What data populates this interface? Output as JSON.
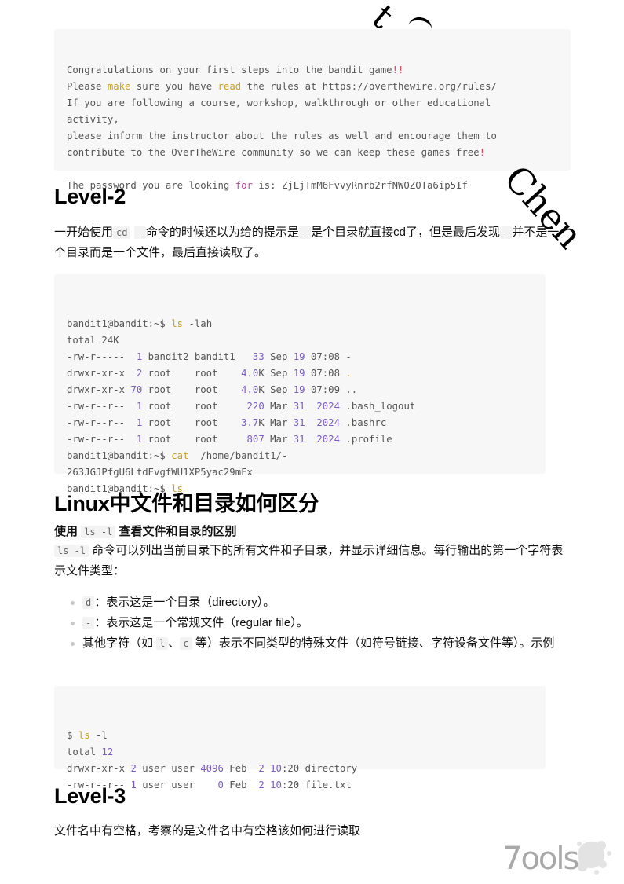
{
  "intro_code": {
    "lines": [
      [
        {
          "t": "Congratulations on your first steps into the bandit game"
        },
        {
          "t": "!!",
          "c": "kw-r"
        }
      ],
      [
        {
          "t": "Please "
        },
        {
          "t": "make",
          "c": "kw-y"
        },
        {
          "t": " sure you have "
        },
        {
          "t": "read",
          "c": "kw-y"
        },
        {
          "t": " the rules at https://overthewire.org/rules/"
        }
      ],
      [
        {
          "t": "If you are following a course, workshop, walkthrough or other educational"
        }
      ],
      [
        {
          "t": "activity,"
        }
      ],
      [
        {
          "t": "please inform the instructor about the rules as well and encourage them to"
        }
      ],
      [
        {
          "t": "contribute to the OverTheWire community so we can keep these games free"
        },
        {
          "t": "!",
          "c": "kw-r"
        }
      ],
      [
        {
          "t": ""
        }
      ],
      [
        {
          "t": "The password you are looking "
        },
        {
          "t": "for",
          "c": "kw-m"
        },
        {
          "t": " is: ZjLjTmM6FvvyRnrb2rfNWOZOTa6ip5If"
        }
      ]
    ]
  },
  "level2": {
    "heading": "Level-2",
    "para_part1": "一开始使用",
    "para_code1": "cd",
    "para_code2": "-",
    "para_part2": "命令的时候还以为给的提示是",
    "para_code3": "-",
    "para_part3": "是个目录就直接cd了，但是最后发现",
    "para_code4": "-",
    "para_part4": "并不是一个目录而是一个文件，最后直接读取了。",
    "code_lines": [
      [
        {
          "t": "bandit1@bandit:~$ "
        },
        {
          "t": "ls",
          "c": "kw-y"
        },
        {
          "t": " -lah"
        }
      ],
      [
        {
          "t": "total 24K"
        }
      ],
      [
        {
          "t": "-rw-r-----  "
        },
        {
          "t": "1",
          "c": "kw-p"
        },
        {
          "t": " bandit2 bandit1   "
        },
        {
          "t": "33",
          "c": "kw-p"
        },
        {
          "t": " Sep "
        },
        {
          "t": "19",
          "c": "kw-p"
        },
        {
          "t": " 07:08 -"
        }
      ],
      [
        {
          "t": "drwxr-xr-x  "
        },
        {
          "t": "2",
          "c": "kw-p"
        },
        {
          "t": " root    root    "
        },
        {
          "t": "4.0",
          "c": "kw-p"
        },
        {
          "t": "K Sep "
        },
        {
          "t": "19",
          "c": "kw-p"
        },
        {
          "t": " 07:08 "
        },
        {
          "t": ".",
          "c": "kw-o"
        }
      ],
      [
        {
          "t": "drwxr-xr-x "
        },
        {
          "t": "70",
          "c": "kw-p"
        },
        {
          "t": " root    root    "
        },
        {
          "t": "4.0",
          "c": "kw-p"
        },
        {
          "t": "K Sep "
        },
        {
          "t": "19",
          "c": "kw-p"
        },
        {
          "t": " 07:09 .."
        }
      ],
      [
        {
          "t": "-rw-r--r--  "
        },
        {
          "t": "1",
          "c": "kw-p"
        },
        {
          "t": " root    root     "
        },
        {
          "t": "220",
          "c": "kw-p"
        },
        {
          "t": " Mar "
        },
        {
          "t": "31",
          "c": "kw-p"
        },
        {
          "t": "  "
        },
        {
          "t": "2024",
          "c": "kw-p"
        },
        {
          "t": " .bash_logout"
        }
      ],
      [
        {
          "t": "-rw-r--r--  "
        },
        {
          "t": "1",
          "c": "kw-p"
        },
        {
          "t": " root    root    "
        },
        {
          "t": "3.7",
          "c": "kw-p"
        },
        {
          "t": "K Mar "
        },
        {
          "t": "31",
          "c": "kw-p"
        },
        {
          "t": "  "
        },
        {
          "t": "2024",
          "c": "kw-p"
        },
        {
          "t": " .bashrc"
        }
      ],
      [
        {
          "t": "-rw-r--r--  "
        },
        {
          "t": "1",
          "c": "kw-p"
        },
        {
          "t": " root    root     "
        },
        {
          "t": "807",
          "c": "kw-p"
        },
        {
          "t": " Mar "
        },
        {
          "t": "31",
          "c": "kw-p"
        },
        {
          "t": "  "
        },
        {
          "t": "2024",
          "c": "kw-p"
        },
        {
          "t": " .profile"
        }
      ],
      [
        {
          "t": "bandit1@bandit:~$ "
        },
        {
          "t": "cat",
          "c": "kw-y"
        },
        {
          "t": "  /home/bandit1/-"
        }
      ],
      [
        {
          "t": "263JGJPfgU6LtdEvgfWU1XP5yac29mFx"
        }
      ],
      [
        {
          "t": "bandit1@bandit:~$ "
        },
        {
          "t": "ls",
          "c": "kw-y"
        }
      ]
    ]
  },
  "linux_section": {
    "heading": "Linux中文件和目录如何区分",
    "subheading_prefix": "使用",
    "subheading_code": "ls -l",
    "subheading_suffix": "查看文件和目录的区别",
    "para_code": "ls -l",
    "para_text": "命令可以列出当前目录下的所有文件和子目录，并显示详细信息。每行输出的第一个字符表示文件类型：",
    "bullets": [
      {
        "code": "d",
        "text": "：表示这是一个目录（directory）。"
      },
      {
        "code": "-",
        "text": "：表示这是一个常规文件（regular file）。"
      },
      {
        "prefix": "其他字符（如 ",
        "code1": "l",
        "sep": "、",
        "code2": "c",
        "text": " 等）表示不同类型的特殊文件（如符号链接、字符设备文件等）。示例"
      }
    ],
    "code_lines": [
      [
        {
          "t": "$ "
        },
        {
          "t": "ls",
          "c": "kw-y"
        },
        {
          "t": " -l"
        }
      ],
      [
        {
          "t": "total "
        },
        {
          "t": "12",
          "c": "kw-p"
        }
      ],
      [
        {
          "t": "drwxr-xr-x "
        },
        {
          "t": "2",
          "c": "kw-p"
        },
        {
          "t": " user user "
        },
        {
          "t": "4096",
          "c": "kw-p"
        },
        {
          "t": " Feb  "
        },
        {
          "t": "2",
          "c": "kw-p"
        },
        {
          "t": " "
        },
        {
          "t": "10",
          "c": "kw-p"
        },
        {
          "t": ":20 directory"
        }
      ],
      [
        {
          "t": "-rw-r--r-- "
        },
        {
          "t": "1",
          "c": "kw-p"
        },
        {
          "t": " user user    "
        },
        {
          "t": "0",
          "c": "kw-p"
        },
        {
          "t": " Feb  "
        },
        {
          "t": "2",
          "c": "kw-p"
        },
        {
          "t": " "
        },
        {
          "t": "10",
          "c": "kw-p"
        },
        {
          "t": ":20 file.txt"
        }
      ]
    ]
  },
  "level3": {
    "heading": "Level-3",
    "para": "文件名中有空格，考察的是文件名中有空格该如何进行读取"
  },
  "watermark": {
    "text_top": "t",
    "text_side": "Chen"
  },
  "logo": {
    "text": "7ools"
  }
}
